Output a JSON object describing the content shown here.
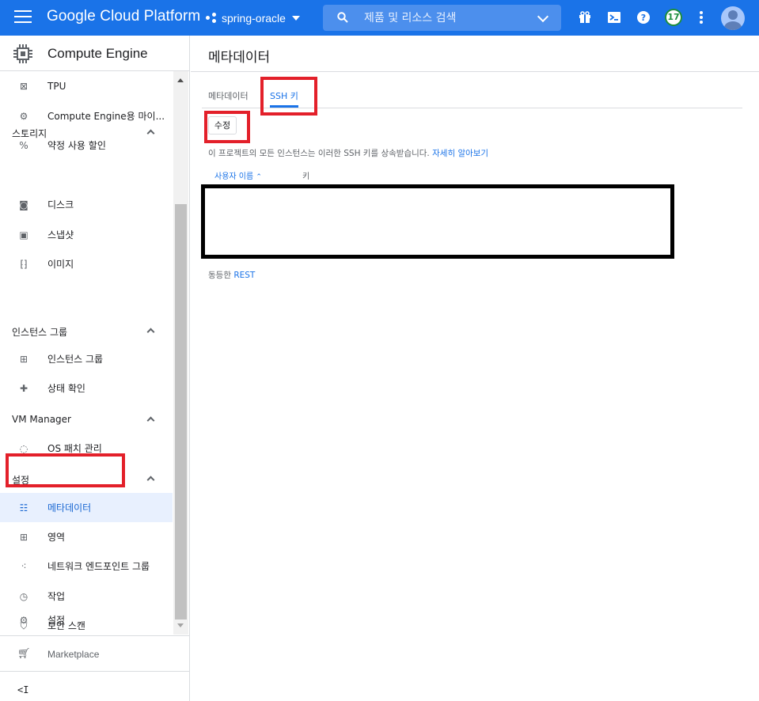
{
  "topbar": {
    "brand": "Google Cloud Platform",
    "project": "spring-oracle",
    "search_placeholder": "제품 및 리소스 검색",
    "notification_count": "17",
    "icons": [
      "gift-icon",
      "cloud-shell-icon",
      "help-icon",
      "notifications-icon",
      "more-vert-icon",
      "account-avatar-icon"
    ]
  },
  "sidebar": {
    "product_title": "Compute Engine",
    "items_top": [
      {
        "label": "TPU",
        "icon": "tpu-icon"
      },
      {
        "label": "Compute Engine용 마이...",
        "icon": "migrate-icon"
      },
      {
        "label": "약정 사용 할인",
        "icon": "percent-icon"
      }
    ],
    "sections": [
      {
        "title": "스토리지",
        "items": [
          {
            "label": "디스크",
            "icon": "disk-icon"
          },
          {
            "label": "스냅샷",
            "icon": "snapshot-icon"
          },
          {
            "label": "이미지",
            "icon": "image-icon"
          }
        ]
      },
      {
        "title": "인스턴스 그룹",
        "items": [
          {
            "label": "인스턴스 그룹",
            "icon": "instance-group-icon"
          },
          {
            "label": "상태 확인",
            "icon": "health-check-icon"
          }
        ]
      },
      {
        "title": "VM Manager",
        "items": [
          {
            "label": "OS 패치 관리",
            "icon": "os-patch-icon"
          }
        ]
      },
      {
        "title": "설정",
        "items": [
          {
            "label": "메타데이터",
            "icon": "metadata-icon",
            "active": true
          },
          {
            "label": "영역",
            "icon": "zones-icon"
          },
          {
            "label": "네트워크 엔드포인트 그룹",
            "icon": "network-endpoint-icon"
          },
          {
            "label": "작업",
            "icon": "clock-icon"
          },
          {
            "label": "보안 스캔",
            "icon": "shield-icon"
          },
          {
            "label": "설정",
            "icon": "gear-icon"
          }
        ]
      }
    ],
    "marketplace": "Marketplace",
    "collapse": "<I"
  },
  "main": {
    "page_title": "메타데이터",
    "tabs": [
      {
        "label": "메타데이터",
        "active": false
      },
      {
        "label": "SSH 키",
        "active": true
      }
    ],
    "edit_button": "수정",
    "info_text": "이 프로젝트의 모든 인스턴스는 이러한 SSH 키를 상속받습니다.",
    "learn_more": "자세히 알아보기",
    "columns": {
      "user": "사용자 이름",
      "key": "키"
    },
    "equivalent_prefix": "동등한",
    "equivalent_link": "REST"
  },
  "colors": {
    "topbar": "#1a73e8",
    "highlight": "#e3202a",
    "active_item_bg": "#e8f0fe"
  }
}
